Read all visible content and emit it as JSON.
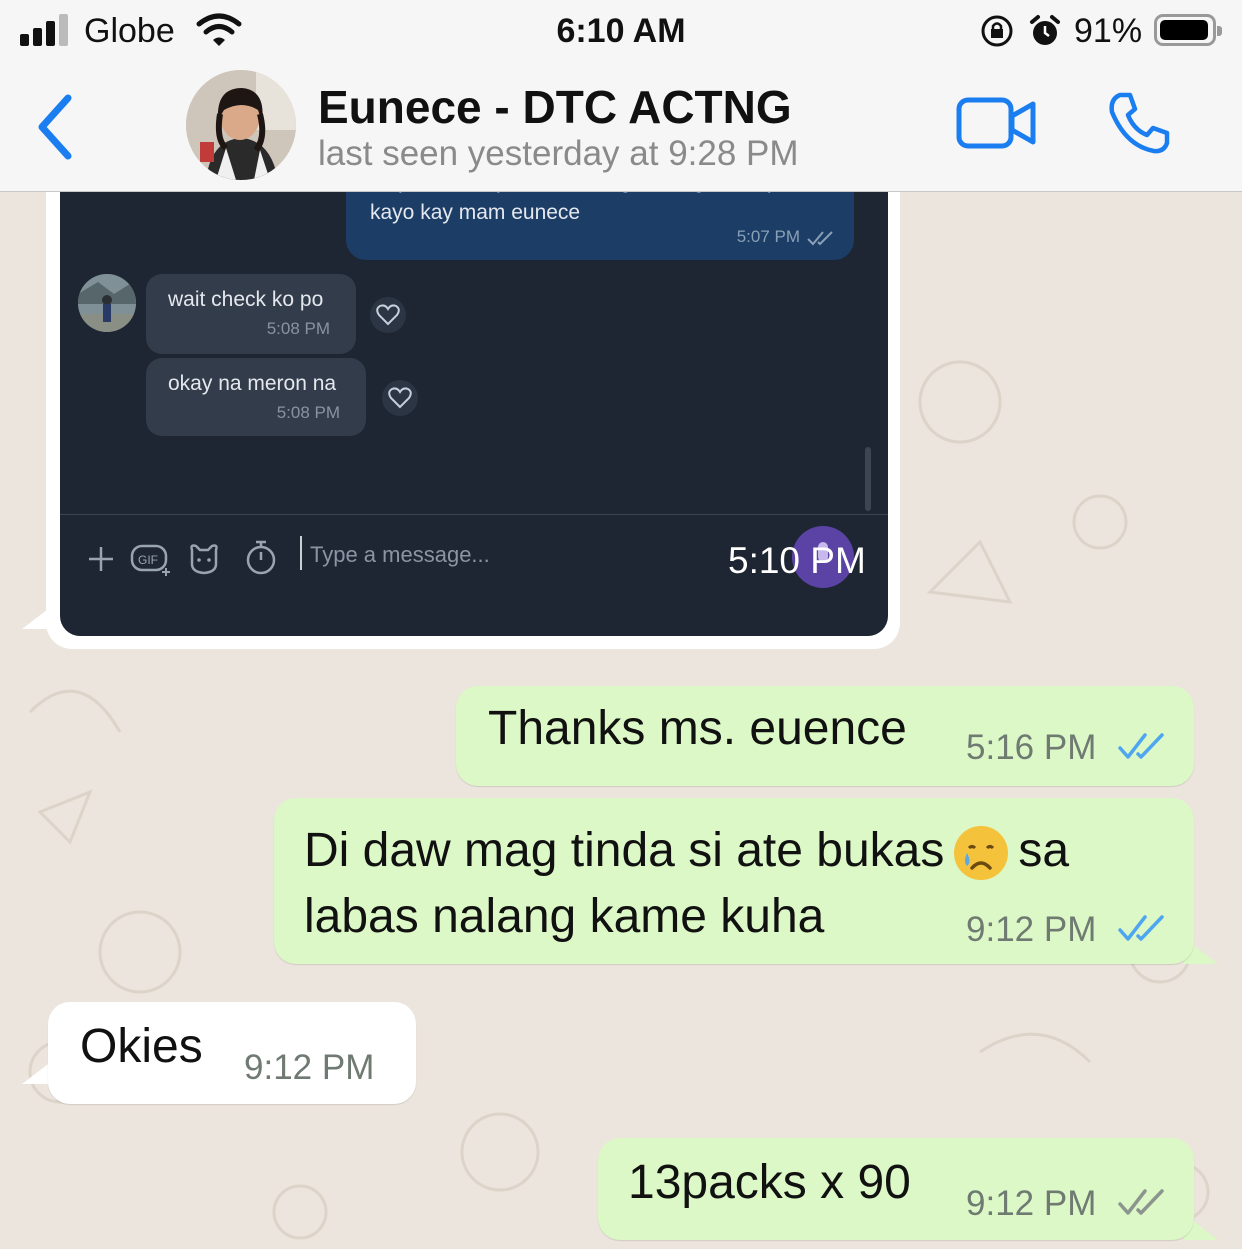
{
  "status_bar": {
    "carrier": "Globe",
    "time": "6:10 AM",
    "battery": "91%",
    "battery_level": 0.91,
    "signal_bars_filled": 3,
    "signal_bars_total": 4
  },
  "header": {
    "contact_name": "Eunece - DTC ACTNG",
    "last_seen": "last seen yesterday at 9:28 PM",
    "icons": [
      "chevron-left-icon",
      "video-call-icon",
      "phone-icon"
    ],
    "accent_color": "#1a7df0"
  },
  "screenshot_bubble": {
    "outgoing_text": "sir paconfirm po ito kasi nagmessage daw po kayo kay mam eunece",
    "outgoing_time": "5:07 PM",
    "incoming": [
      {
        "text": "wait check ko po",
        "time": "5:08 PM"
      },
      {
        "text": "okay na meron na",
        "time": "5:08 PM"
      }
    ],
    "composer_placeholder": "Type a message...",
    "time": "5:10 PM"
  },
  "messages": [
    {
      "direction": "out",
      "text": "Thanks ms. euence",
      "time": "5:16 PM",
      "read": true
    },
    {
      "direction": "out",
      "text_before_emoji": "Di daw mag tinda si ate bukas",
      "emoji": "crying-face",
      "text_after_emoji_line1": "sa",
      "text_line2": "labas nalang kame kuha",
      "time": "9:12 PM",
      "read": true
    },
    {
      "direction": "in",
      "text": "Okies",
      "time": "9:12 PM"
    },
    {
      "direction": "out",
      "text": "13packs x 90",
      "time": "9:12 PM",
      "read": false
    }
  ],
  "colors": {
    "chat_background": "#ece5dd",
    "outgoing_bubble": "#dcf8c6",
    "incoming_bubble": "#ffffff",
    "read_ticks": "#4fa6f0",
    "unread_ticks": "#8c948e"
  }
}
